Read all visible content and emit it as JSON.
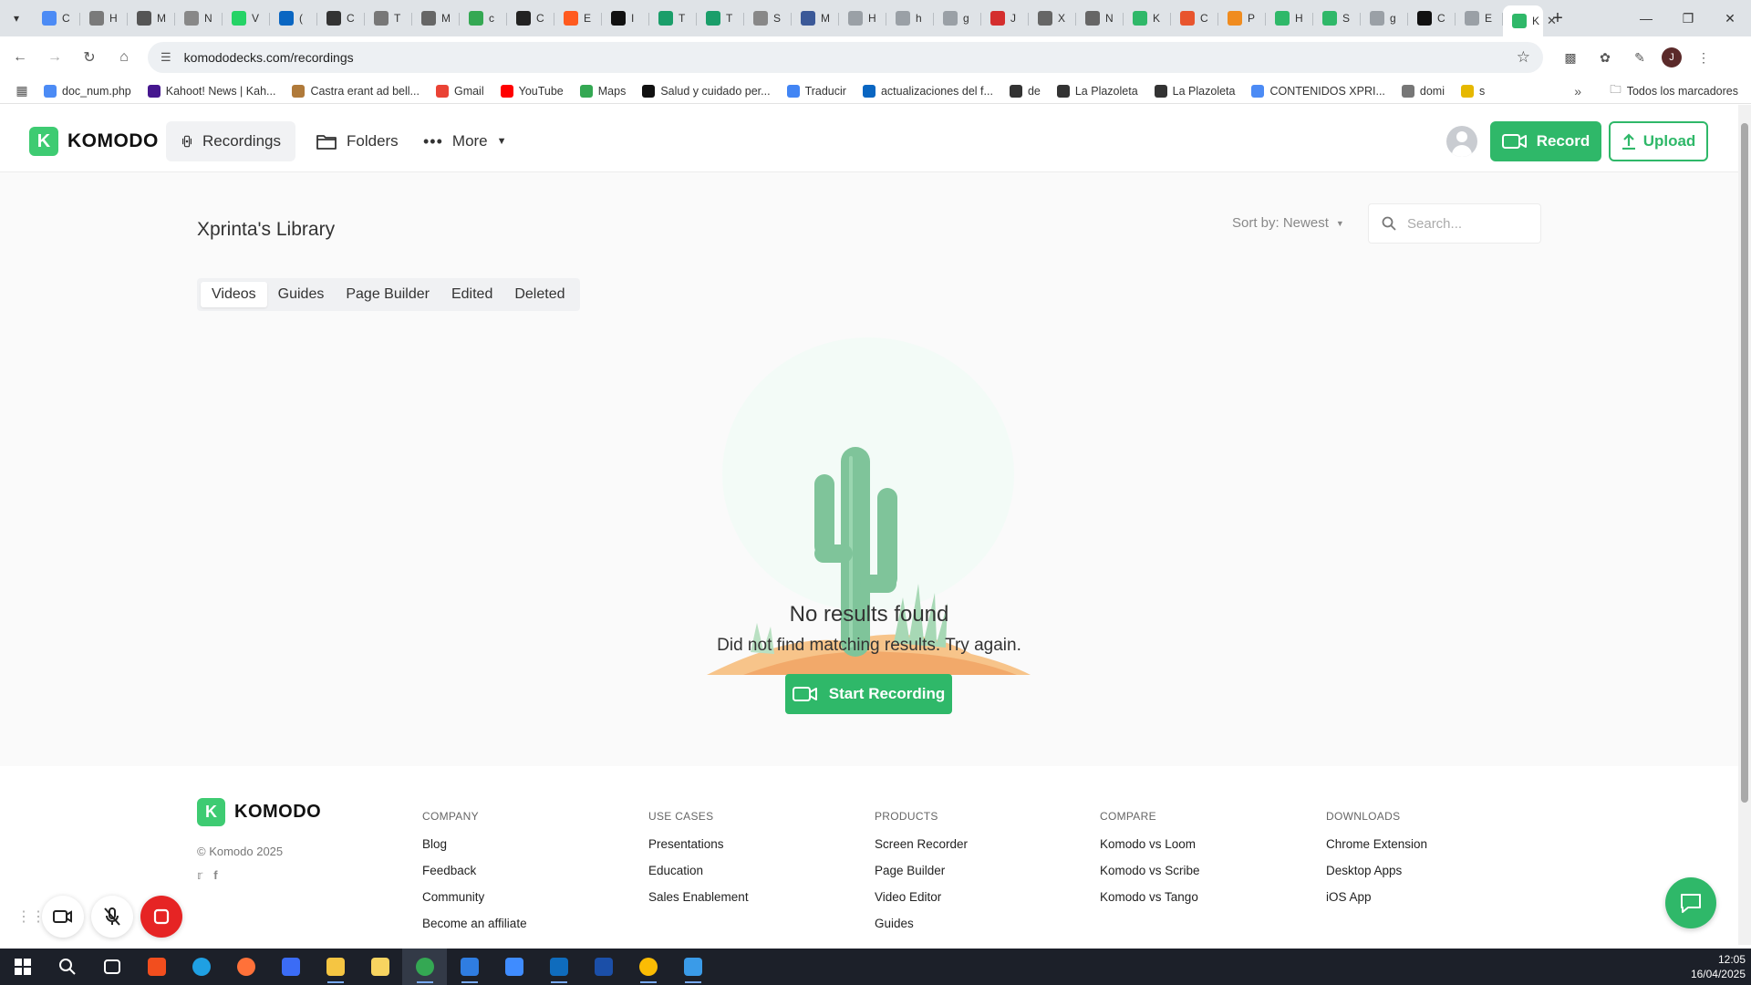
{
  "browser": {
    "tabs": [
      {
        "label": "C",
        "color": "#4c8bf5"
      },
      {
        "label": "H",
        "color": "#7a7a7a"
      },
      {
        "label": "M",
        "color": "#555555"
      },
      {
        "label": "N",
        "color": "#888888"
      },
      {
        "label": "V",
        "color": "#25d366"
      },
      {
        "label": "(",
        "color": "#0a66c2"
      },
      {
        "label": "C",
        "color": "#333333"
      },
      {
        "label": "T",
        "color": "#777777"
      },
      {
        "label": "M",
        "color": "#666666"
      },
      {
        "label": "c",
        "color": "#34a853"
      },
      {
        "label": "C",
        "color": "#222222"
      },
      {
        "label": "E",
        "color": "#ff5a1f"
      },
      {
        "label": "I",
        "color": "#111111"
      },
      {
        "label": "T",
        "color": "#1a9e6a"
      },
      {
        "label": "T",
        "color": "#1a9e6a"
      },
      {
        "label": "S",
        "color": "#888888"
      },
      {
        "label": "M",
        "color": "#3b5998"
      },
      {
        "label": "H",
        "color": "#9aa0a6"
      },
      {
        "label": "h",
        "color": "#9aa0a6"
      },
      {
        "label": "g",
        "color": "#9aa0a6"
      },
      {
        "label": "J",
        "color": "#d42e2e"
      },
      {
        "label": "X",
        "color": "#666666"
      },
      {
        "label": "N",
        "color": "#666666"
      },
      {
        "label": "K",
        "color": "#2fb869"
      },
      {
        "label": "C",
        "color": "#e8552e"
      },
      {
        "label": "P",
        "color": "#f08c1f"
      },
      {
        "label": "H",
        "color": "#2fb869"
      },
      {
        "label": "S",
        "color": "#2fb869"
      },
      {
        "label": "g",
        "color": "#9aa0a6"
      },
      {
        "label": "C",
        "color": "#111111"
      },
      {
        "label": "E",
        "color": "#9aa0a6"
      }
    ],
    "active_tab": {
      "label": "K",
      "color": "#2fb869"
    },
    "url": "komododecks.com/recordings",
    "profile_initial": "J"
  },
  "bookmarks": {
    "items": [
      {
        "label": "doc_num.php",
        "color": "#4c8bf5"
      },
      {
        "label": "Kahoot! News | Kah...",
        "color": "#46178f"
      },
      {
        "label": "Castra erant ad bell...",
        "color": "#b07a3a"
      },
      {
        "label": "Gmail",
        "color": "#ea4335"
      },
      {
        "label": "YouTube",
        "color": "#ff0000"
      },
      {
        "label": "Maps",
        "color": "#34a853"
      },
      {
        "label": "Salud y cuidado per...",
        "color": "#111111"
      },
      {
        "label": "Traducir",
        "color": "#4285f4"
      },
      {
        "label": "actualizaciones del f...",
        "color": "#0a66c2"
      },
      {
        "label": "de",
        "color": "#333333"
      },
      {
        "label": "La Plazoleta",
        "color": "#333333"
      },
      {
        "label": "La Plazoleta",
        "color": "#333333"
      },
      {
        "label": "CONTENIDOS XPRI...",
        "color": "#4c8bf5"
      },
      {
        "label": "domi",
        "color": "#777777"
      },
      {
        "label": "s",
        "color": "#e6b800"
      }
    ],
    "all_label": "Todos los marcadores"
  },
  "app": {
    "brand": "KOMODO",
    "brand_mark": "K",
    "nav": {
      "recordings": "Recordings",
      "folders": "Folders",
      "more": "More"
    },
    "record_label": "Record",
    "upload_label": "Upload",
    "accent": "#2fb869"
  },
  "library": {
    "title": "Xprinta's Library",
    "sort_label": "Sort by: Newest",
    "search_placeholder": "Search...",
    "tabs": [
      "Videos",
      "Guides",
      "Page Builder",
      "Edited",
      "Deleted"
    ],
    "active_tab": "Videos",
    "empty_title": "No results found",
    "empty_subtitle": "Did not find matching results. Try again.",
    "start_label": "Start Recording"
  },
  "footer": {
    "brand": "KOMODO",
    "copyright": "© Komodo 2025",
    "columns": [
      {
        "heading": "COMPANY",
        "links": [
          "Blog",
          "Feedback",
          "Community",
          "Become an affiliate"
        ]
      },
      {
        "heading": "USE CASES",
        "links": [
          "Presentations",
          "Education",
          "Sales Enablement"
        ]
      },
      {
        "heading": "PRODUCTS",
        "links": [
          "Screen Recorder",
          "Page Builder",
          "Video Editor",
          "Guides"
        ]
      },
      {
        "heading": "COMPARE",
        "links": [
          "Komodo vs Loom",
          "Komodo vs Scribe",
          "Komodo vs Tango"
        ]
      },
      {
        "heading": "DOWNLOADS",
        "links": [
          "Chrome Extension",
          "Desktop Apps",
          "iOS App"
        ]
      }
    ]
  },
  "taskbar": {
    "time": "12:05",
    "date": "16/04/2025",
    "apps": [
      {
        "name": "task-view",
        "color": "#ffffff"
      },
      {
        "name": "figma",
        "color": "#f24e1e"
      },
      {
        "name": "edge",
        "color": "#1fa0e3"
      },
      {
        "name": "firefox",
        "color": "#ff7139"
      },
      {
        "name": "app-blue",
        "color": "#3b6cf6"
      },
      {
        "name": "file-explorer",
        "color": "#f5c542"
      },
      {
        "name": "notes",
        "color": "#f7d460"
      },
      {
        "name": "chrome",
        "color": "#34a853"
      },
      {
        "name": "mail",
        "color": "#2f7de1"
      },
      {
        "name": "store",
        "color": "#3f8cff"
      },
      {
        "name": "outlook",
        "color": "#0f6cbd"
      },
      {
        "name": "app-clock",
        "color": "#1b4fa8"
      },
      {
        "name": "chrome-2",
        "color": "#fbbc04"
      },
      {
        "name": "paint",
        "color": "#3a9be8"
      }
    ]
  }
}
